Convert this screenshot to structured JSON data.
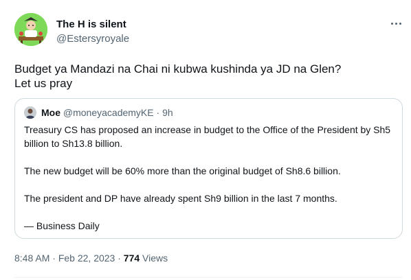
{
  "author": {
    "display_name": "The H is silent",
    "handle": "@Estersyroyale",
    "avatar_icon": "cartoon-avatar-icon",
    "avatar_color": "#7dd957"
  },
  "more_icon": "more-options-icon",
  "tweet": {
    "lines": [
      "Budget ya Mandazi na Chai ni kubwa kushinda ya JD na Glen?",
      "Let us pray"
    ]
  },
  "quoted": {
    "display_name": "Moe",
    "handle": "@moneyacademyKE",
    "separator": "·",
    "time": "9h",
    "avatar_icon": "profile-photo-icon",
    "paragraphs": [
      "Treasury CS has proposed an increase in budget to the Office of the President by Sh5 billion to Sh13.8 billion.",
      "The new budget will be 60% more than the original budget of Sh8.6 billion.",
      "The president and DP have already spent Sh9 billion in the last 7 months.",
      "— Business Daily"
    ]
  },
  "footer": {
    "time": "8:48 AM",
    "separator": "·",
    "date": "Feb 22, 2023",
    "views_count": "774",
    "views_label": "Views"
  },
  "colors": {
    "text_primary": "#0f1419",
    "text_secondary": "#536471",
    "border": "#cfd9de"
  }
}
